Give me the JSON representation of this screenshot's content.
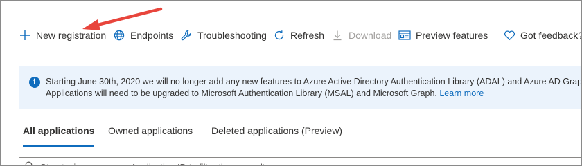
{
  "toolbar": {
    "new_registration": "New registration",
    "endpoints": "Endpoints",
    "troubleshooting": "Troubleshooting",
    "refresh": "Refresh",
    "download": "Download",
    "preview_features": "Preview features",
    "got_feedback": "Got feedback?"
  },
  "banner": {
    "line1": "Starting June 30th, 2020 we will no longer add any new features to Azure Active Directory Authentication Library (ADAL) and Azure AD Graph. We w",
    "line2": "Applications will need to be upgraded to Microsoft Authentication Library (MSAL) and Microsoft Graph.",
    "link": "Learn more"
  },
  "tabs": [
    {
      "label": "All applications",
      "active": true
    },
    {
      "label": "Owned applications",
      "active": false
    },
    {
      "label": "Deleted applications (Preview)",
      "active": false
    }
  ],
  "search": {
    "placeholder": "Start typing a name or Application ID to filter these results"
  },
  "colors": {
    "accent": "#0f6cbd",
    "banner_bg": "#ebf3fc",
    "arrow": "#e8453c",
    "disabled_text": "#a19f9d"
  }
}
